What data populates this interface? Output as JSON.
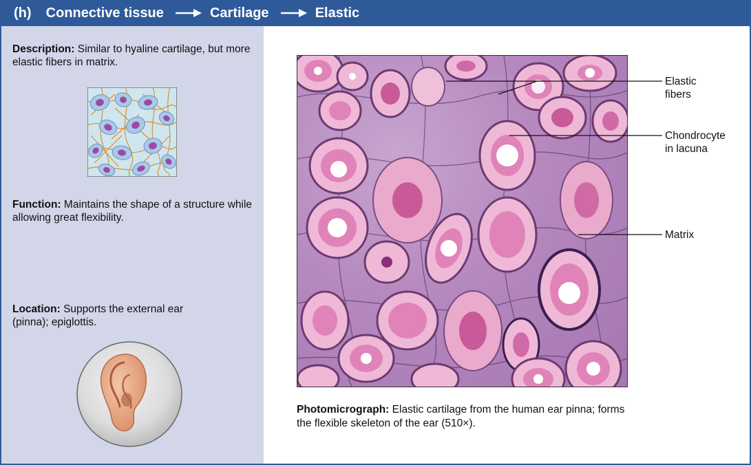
{
  "header": {
    "part1": "(h)",
    "part2": "Connective tissue",
    "part3": "Cartilage",
    "part4": "Elastic"
  },
  "description": {
    "label": "Description:",
    "text": "Similar to hyaline cartilage, but more elastic fibers in matrix."
  },
  "function": {
    "label": "Function:",
    "text": "Maintains the shape of a structure while allowing great flexibility."
  },
  "location": {
    "label": "Location:",
    "text": "Supports the external ear (pinna); epiglottis."
  },
  "labels": {
    "elastic_fibers_1": "Elastic",
    "elastic_fibers_2": "fibers",
    "chondrocyte_1": "Chondrocyte",
    "chondrocyte_2": "in lacuna",
    "matrix": "Matrix"
  },
  "caption": {
    "label": "Photomicrograph:",
    "text": "Elastic cartilage from the human ear pinna; forms the flexible skeleton of the ear (510×)."
  },
  "colors": {
    "header_bg": "#2f5a9a",
    "left_panel_bg": "#d2d6e8",
    "cell_pink": "#e58bbd",
    "nucleus_purple": "#8a2f7c",
    "fiber_orange": "#d88a1a"
  }
}
